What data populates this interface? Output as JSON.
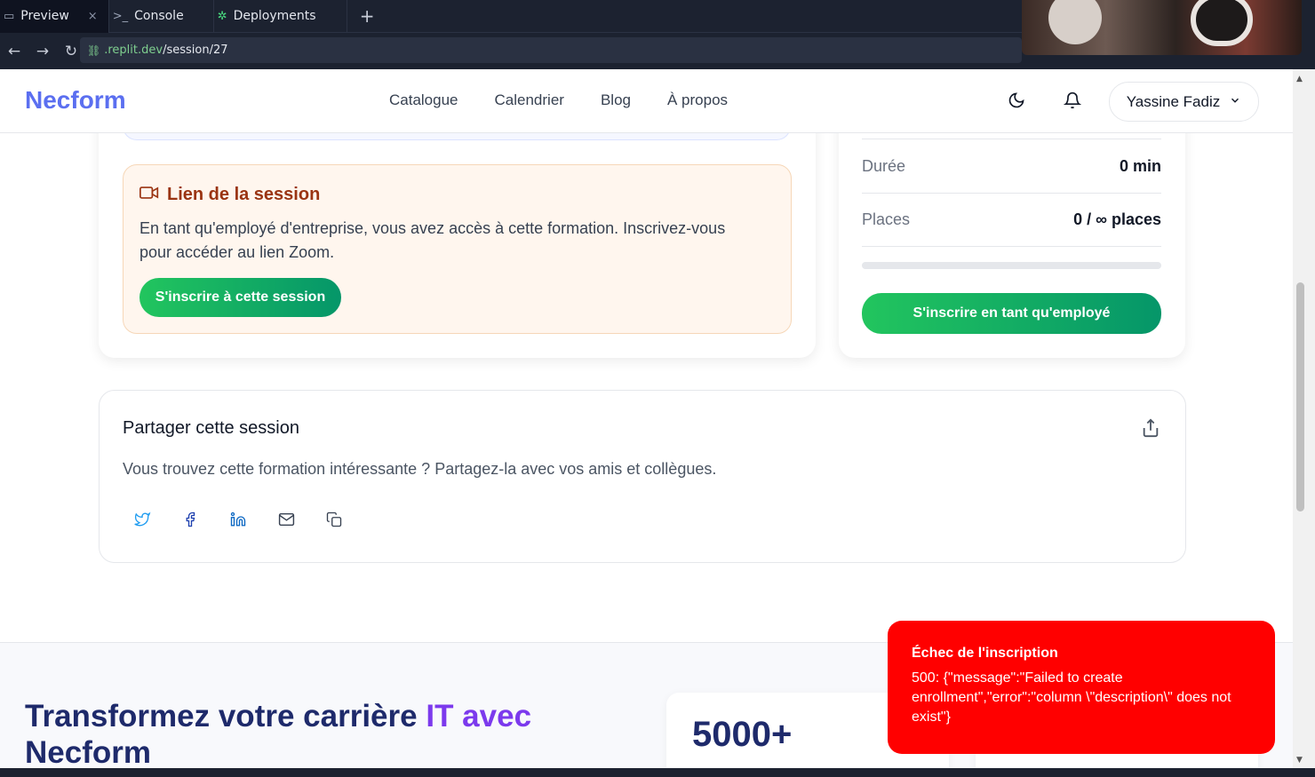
{
  "ide": {
    "tabs": [
      {
        "label": "Preview",
        "close": "×"
      },
      {
        "label": "Console"
      },
      {
        "label": "Deployments"
      }
    ],
    "add_tab": "+",
    "url": {
      "host": ".replit.dev",
      "path": "/session/27"
    }
  },
  "header": {
    "logo": "Necform",
    "nav": [
      "Catalogue",
      "Calendrier",
      "Blog",
      "À propos"
    ],
    "user_name": "Yassine Fadiz"
  },
  "session_link": {
    "title": "Lien de la session",
    "text": "En tant qu'employé d'entreprise, vous avez accès à cette formation. Inscrivez-vous pour accéder au lien Zoom.",
    "button": "S'inscrire à cette session"
  },
  "info": {
    "rows": [
      {
        "label": "Durée",
        "value": "0 min"
      },
      {
        "label": "Places",
        "value": "0 / ∞ places"
      }
    ],
    "progress_fraction": 0,
    "button": "S'inscrire en tant qu'employé"
  },
  "share": {
    "title": "Partager cette session",
    "text": "Vous trouvez cette formation intéressante ? Partagez-la avec vos amis et collègues."
  },
  "cta": {
    "title_part1": "Transformez votre carrière",
    "title_part2": "IT avec",
    "title_part3": "Necform",
    "stat": "5000+"
  },
  "toast": {
    "title": "Échec de l'inscription",
    "message": "500: {\"message\":\"Failed to create enrollment\",\"error\":\"column \\\"description\\\" does not exist\"}"
  },
  "colors": {
    "brand": "#5b6ff0",
    "green": "#22c55e",
    "error": "#ff0000",
    "session_title": "#9a3412"
  }
}
